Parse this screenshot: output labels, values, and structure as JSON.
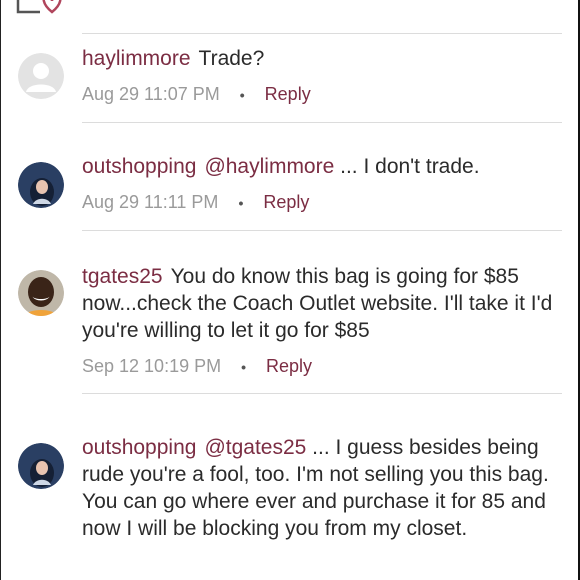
{
  "comments": [
    {
      "username": "haylimmore",
      "mention": "",
      "text": "Trade?",
      "timestamp": "Aug 29 11:07 PM",
      "reply_label": "Reply",
      "avatar": "default-avatar-icon"
    },
    {
      "username": "outshopping",
      "mention": "@haylimmore",
      "text": " ... I don't trade.",
      "timestamp": "Aug 29 11:11 PM",
      "reply_label": "Reply",
      "avatar": "user-photo"
    },
    {
      "username": "tgates25",
      "mention": "",
      "text": "You do know this bag is going for $85 now...check the Coach Outlet website. I'll take it I'd you're willing to let it go for $85",
      "timestamp": "Sep 12 10:19 PM",
      "reply_label": "Reply",
      "avatar": "user-photo"
    },
    {
      "username": "outshopping",
      "mention": "@tgates25",
      "text": " ... I guess besides being rude you're a fool, too. I'm not selling you this bag. You can go where ever and purchase it for 85 and now I will be blocking you from my closet.",
      "timestamp": "",
      "reply_label": "",
      "avatar": "user-photo"
    }
  ],
  "separator": "•",
  "colors": {
    "accent": "#7b2d43",
    "text": "#2b2b2b",
    "meta": "#9a9a9a",
    "divider": "#dcdcdc"
  },
  "top_icon": "heart-bag-icon"
}
